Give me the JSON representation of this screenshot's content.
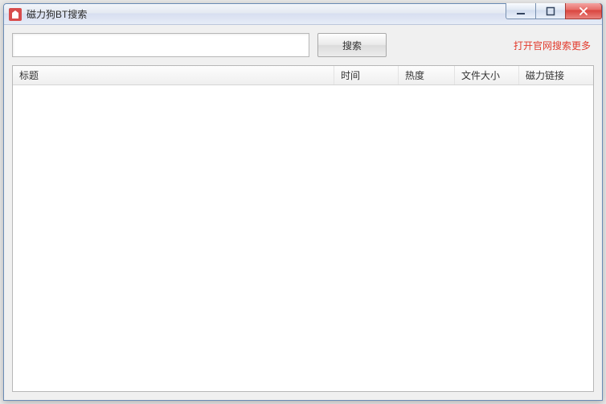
{
  "window": {
    "title": "磁力狗BT搜索"
  },
  "search": {
    "value": "",
    "placeholder": "",
    "button_label": "搜索",
    "official_link_label": "打开官网搜索更多"
  },
  "columns": {
    "title": "标题",
    "time": "时间",
    "heat": "热度",
    "size": "文件大小",
    "magnet": "磁力链接"
  },
  "results": []
}
